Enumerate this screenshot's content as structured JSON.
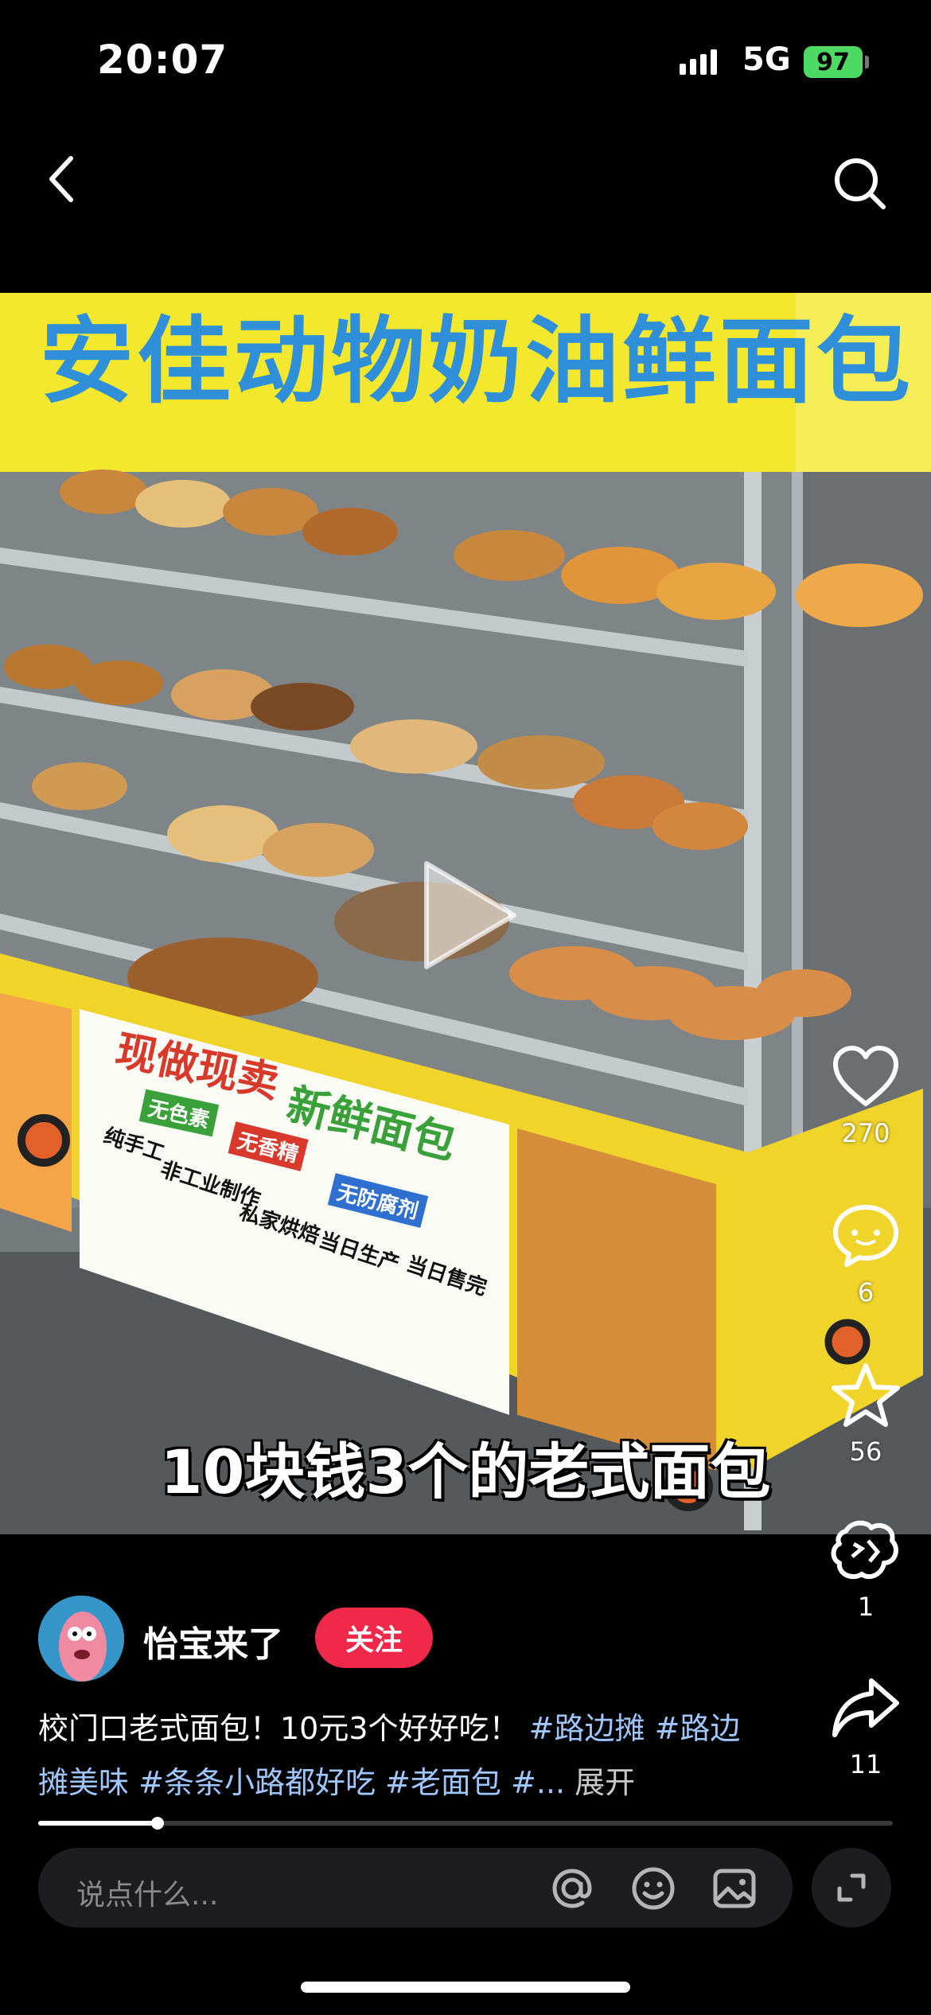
{
  "status_bar": {
    "time": "20:07",
    "network": "5G",
    "battery": "97"
  },
  "nav": {
    "back_icon": "chevron-left-icon",
    "search_icon": "search-icon"
  },
  "video": {
    "banner": "安佳动物奶油鲜面包",
    "sign": {
      "title": "现做现卖",
      "subtitle": "新鲜面包",
      "chips": [
        "无色素",
        "无香精",
        "无防腐剂"
      ],
      "lines": [
        "纯手工",
        "非工业制作",
        "私家烘焙",
        "当日生产",
        "当日售完"
      ]
    },
    "caption": "10块钱3个的老式面包",
    "colors": {
      "banner_bg": "#f3e82e",
      "banner_text": "#2f8fd8",
      "sign_red": "#d8392b",
      "sign_green": "#3aa03a"
    }
  },
  "actions": {
    "like_count": "270",
    "comment_count": "6",
    "favorite_count": "56",
    "recommend_count": "1",
    "share_count": "11"
  },
  "author": {
    "name": "怡宝来了",
    "follow_label": "关注"
  },
  "description": {
    "text": "校门口老式面包！10元3个好好吃！",
    "tags": [
      "#路边摊",
      "#路边摊美味",
      "#条条小路都好吃",
      "#老面包",
      "#..."
    ],
    "expand_label": "展开"
  },
  "playback": {
    "progress": 0.14
  },
  "comment_bar": {
    "placeholder": "说点什么..."
  },
  "theme": {
    "follow_red": "#f0284a",
    "tag_blue": "#9ec6ff"
  }
}
